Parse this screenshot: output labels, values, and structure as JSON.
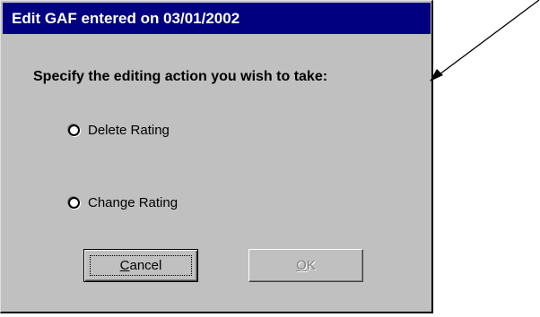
{
  "dialog": {
    "title": "Edit GAF entered on 03/01/2002",
    "prompt": "Specify the editing action you wish to take:",
    "options": [
      {
        "label": "Delete Rating",
        "selected": false
      },
      {
        "label": "Change Rating",
        "selected": false
      }
    ],
    "buttons": {
      "cancel": {
        "accel": "C",
        "rest": "ancel"
      },
      "ok": {
        "accel": "O",
        "rest": "K",
        "enabled": false
      }
    }
  },
  "colors": {
    "titlebar": "#000080",
    "dialog_face": "#c0c0c0",
    "disabled_text": "#808080"
  },
  "annotation": {
    "type": "arrow",
    "icon": "arrow-pointer-icon",
    "color": "#000000"
  }
}
